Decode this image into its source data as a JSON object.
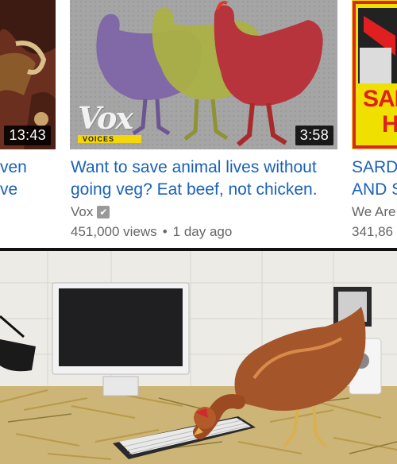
{
  "videos": {
    "left": {
      "duration": "13:43",
      "title_lines": [
        "ven",
        "ve"
      ]
    },
    "main": {
      "duration": "3:58",
      "logo_text": "Vox",
      "logo_subtext": "VOICES",
      "title_lines": [
        "Want to save animal lives without",
        "going veg? Eat beef, not chicken."
      ],
      "channel": "Vox",
      "views": "451,000 views",
      "separator": "•",
      "age": "1 day ago"
    },
    "right": {
      "thumb_text_1": "SAR",
      "thumb_text_2": "H",
      "title_lines": [
        "SARD",
        "AND S"
      ],
      "channel": "We Are",
      "views": "341,86"
    }
  },
  "colors": {
    "link_blue": "#1a62b8",
    "meta_gray": "#666666",
    "duration_bg": "#000000"
  },
  "icons": [
    "checkmark-verified-icon",
    "desk-lamp-icon",
    "computer-monitor-icon",
    "keyboard-icon",
    "chicken-icon"
  ]
}
